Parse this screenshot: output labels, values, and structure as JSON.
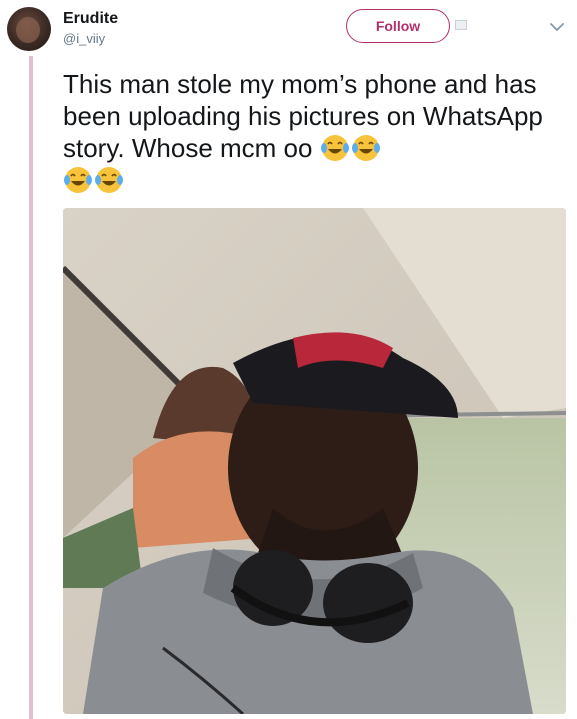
{
  "user": {
    "display_name": "Erudite",
    "handle": "@i_viiy"
  },
  "follow_button": {
    "label": "Follow"
  },
  "tweet": {
    "text_part1": "This man stole my mom’s phone and has been uploading his pictures on WhatsApp story. Whose mcm oo ",
    "emoji_name": "face-with-tears-of-joy",
    "emoji_count": 4
  },
  "colors": {
    "accent": "#b0306d",
    "thread_line": "#e2bfd0",
    "text": "#14171a",
    "muted": "#657786"
  },
  "icons": {
    "more": "chevron-down-icon",
    "avatar": "avatar",
    "media": "tweet-photo"
  }
}
